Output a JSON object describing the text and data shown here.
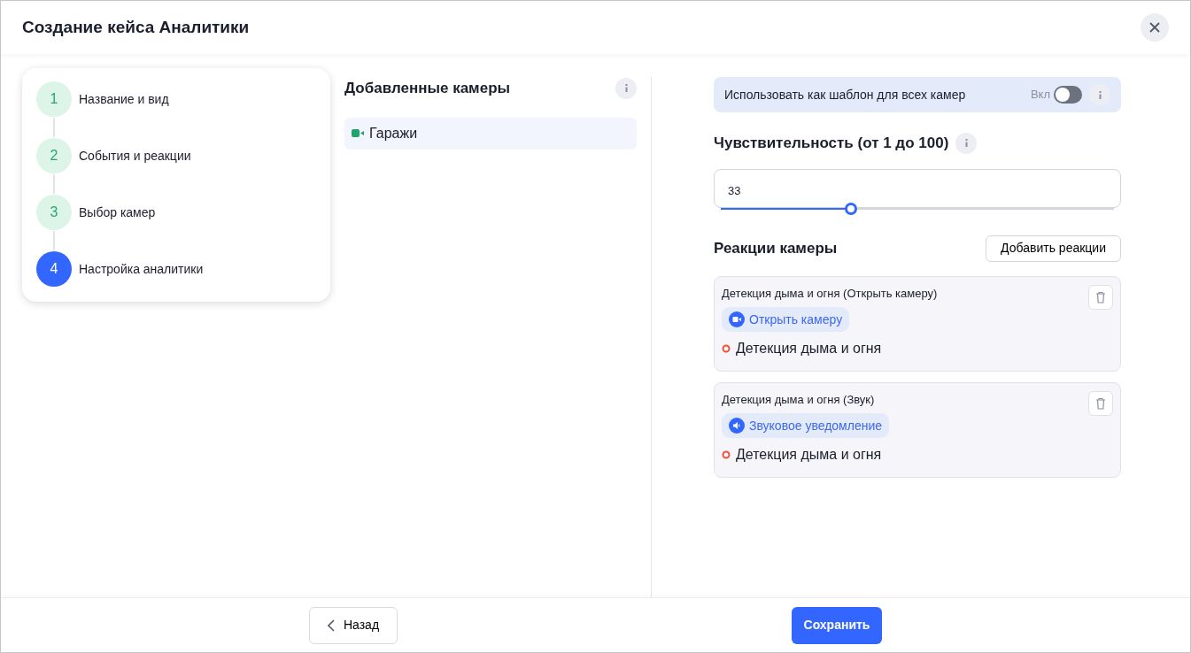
{
  "window": {
    "title": "Создание кейса Аналитики"
  },
  "steps": [
    {
      "number": "1",
      "label": "Название и вид",
      "selected": false
    },
    {
      "number": "2",
      "label": "События и реакции",
      "selected": false
    },
    {
      "number": "3",
      "label": "Выбор камер",
      "selected": false
    },
    {
      "number": "4",
      "label": "Настройка аналитики",
      "selected": true
    }
  ],
  "cameras": {
    "title": "Добавленные камеры",
    "items": [
      {
        "name": "Гаражи"
      }
    ]
  },
  "template": {
    "label": "Использовать как шаблон для всех камер",
    "toggle_label": "Вкл",
    "on": false
  },
  "sensitivity": {
    "title": "Чувствительность (от 1 до 100)",
    "value": "33",
    "level": 0.33
  },
  "reactions": {
    "title": "Реакции камеры",
    "add_button": "Добавить реакции",
    "items": [
      {
        "title": "Детекция дыма и огня (Открыть камеру)",
        "action": {
          "kind": "camera",
          "label": "Открыть камеру"
        },
        "event": "Детекция дыма и огня"
      },
      {
        "title": "Детекция дыма и огня (Звук)",
        "action": {
          "kind": "sound",
          "label": "Звуковое уведомление"
        },
        "event": "Детекция дыма и огня"
      }
    ]
  },
  "footer": {
    "back": "Назад",
    "save": "Сохранить"
  }
}
